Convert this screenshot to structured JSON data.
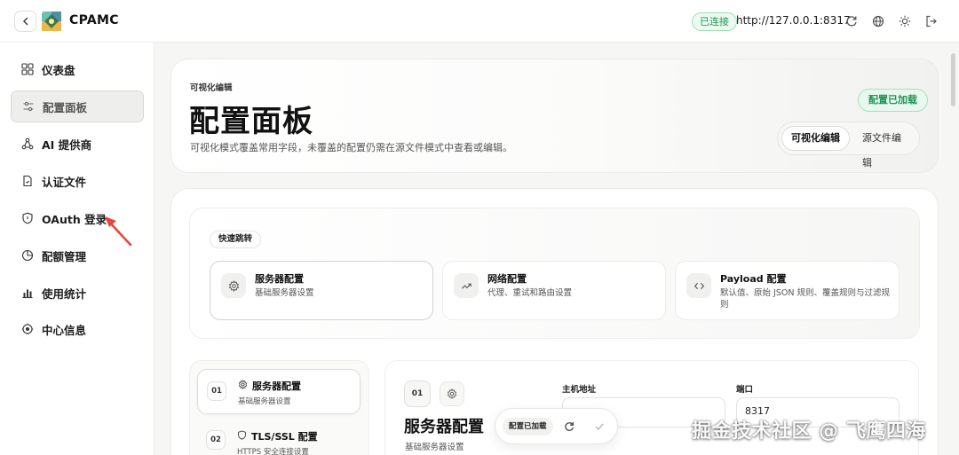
{
  "app": {
    "title": "CPAMC"
  },
  "header": {
    "connection_status": "已连接",
    "server_url": "http://127.0.0.1:8317",
    "icons": [
      "refresh-icon",
      "globe-icon",
      "sun-icon",
      "logout-icon"
    ]
  },
  "sidebar": {
    "items": [
      {
        "label": "仪表盘",
        "icon": "dashboard-icon"
      },
      {
        "label": "配置面板",
        "icon": "sliders-icon",
        "active": true
      },
      {
        "label": "AI 提供商",
        "icon": "network-icon"
      },
      {
        "label": "认证文件",
        "icon": "file-icon"
      },
      {
        "label": "OAuth 登录",
        "icon": "shield-icon"
      },
      {
        "label": "配额管理",
        "icon": "pie-icon"
      },
      {
        "label": "使用统计",
        "icon": "bar-chart-icon"
      },
      {
        "label": "中心信息",
        "icon": "info-center-icon"
      }
    ]
  },
  "hero": {
    "eyebrow": "可视化编辑",
    "title": "配置面板",
    "description": "可视化模式覆盖常用字段，未覆盖的配置仍需在源文件模式中查看或编辑。",
    "status_badge": "配置已加载",
    "modes": [
      "可视化编辑",
      "源文件编辑"
    ],
    "active_mode": "可视化编辑"
  },
  "quick_jump": {
    "label": "快速跳转",
    "cards": [
      {
        "title": "服务器配置",
        "subtitle": "基础服务器设置",
        "icon": "gear-icon"
      },
      {
        "title": "网络配置",
        "subtitle": "代理、重试和路由设置",
        "icon": "trend-icon"
      },
      {
        "title": "Payload 配置",
        "subtitle": "默认值、原始 JSON 规则、覆盖规则与过滤规则",
        "icon": "code-icon"
      }
    ]
  },
  "sections": [
    {
      "number": "01",
      "title": "服务器配置",
      "subtitle": "基础服务器设置",
      "icon": "gear-icon",
      "active": true
    },
    {
      "number": "02",
      "title": "TLS/SSL 配置",
      "subtitle": "HTTPS 安全连接设置",
      "icon": "shield-icon"
    }
  ],
  "detail": {
    "number": "01",
    "title": "服务器配置",
    "subtitle": "基础服务器设置",
    "fields": [
      {
        "label": "主机地址",
        "value": ""
      },
      {
        "label": "端口",
        "value": "8317"
      }
    ]
  },
  "floating_bar": {
    "status": "配置已加载"
  },
  "watermark": "掘金技术社区 @ 飞鹰四海",
  "colors": {
    "accent_green": "#1f9455",
    "annotation_arrow": "#e8453c"
  }
}
